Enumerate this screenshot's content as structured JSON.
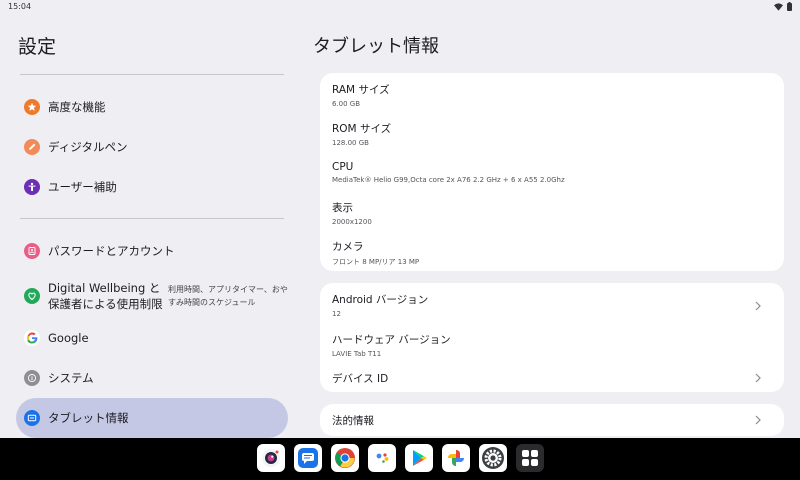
{
  "status_bar": {
    "time": "15:04",
    "icons": [
      "wifi-icon",
      "battery-icon"
    ]
  },
  "left_pane": {
    "title": "設定",
    "items": [
      {
        "label": "高度な機能",
        "icon": "star-icon",
        "icon_color": "#f07a2b"
      },
      {
        "label": "ディジタルペン",
        "icon": "pen-icon",
        "icon_color": "#f28b5a"
      },
      {
        "label": "ユーザー補助",
        "icon": "accessibility-icon",
        "icon_color": "#6c2fb5"
      },
      {
        "label": "パスワードとアカウント",
        "icon": "account-box-icon",
        "icon_color": "#e95d87"
      },
      {
        "label": "Digital Wellbeing と保護者による使用制限",
        "summary": "利用時間、アプリタイマー、おやすみ時間のスケジュール",
        "icon": "wellbeing-icon",
        "icon_color": "#22a85a"
      },
      {
        "label": "Google",
        "icon": "google-icon",
        "icon_color": "#ffffff"
      },
      {
        "label": "システム",
        "icon": "info-icon",
        "icon_color": "#8e8e95"
      },
      {
        "label": "タブレット情報",
        "icon": "tablet-icon",
        "icon_color": "#1a73e8",
        "selected": true
      }
    ]
  },
  "right_pane": {
    "title": "タブレット情報",
    "spec_card": [
      {
        "title": "RAM サイズ",
        "value": "6.00 GB"
      },
      {
        "title": "ROM サイズ",
        "value": "128.00 GB"
      },
      {
        "title": "CPU",
        "value": "MediaTek® Helio G99,Octa core 2x A76 2.2 GHz + 6 x A55 2.0Ghz"
      },
      {
        "title": "表示",
        "value": "2000x1200"
      },
      {
        "title": "カメラ",
        "value": "フロント 8 MP/リア 13 MP"
      }
    ],
    "version_card": [
      {
        "title": "Android バージョン",
        "value": "12",
        "chevron": true
      },
      {
        "title": "ハードウェア バージョン",
        "value": "LAVIE Tab T11",
        "chevron": false
      },
      {
        "title": "デバイス ID",
        "value": "",
        "chevron": true
      }
    ],
    "legal_card": {
      "title": "法的情報",
      "chevron": true
    }
  },
  "dock": {
    "apps": [
      "camera-app-icon",
      "messages-app-icon",
      "chrome-app-icon",
      "assistant-app-icon",
      "play-store-app-icon",
      "photos-app-icon",
      "settings-app-icon",
      "app-drawer-icon"
    ]
  }
}
